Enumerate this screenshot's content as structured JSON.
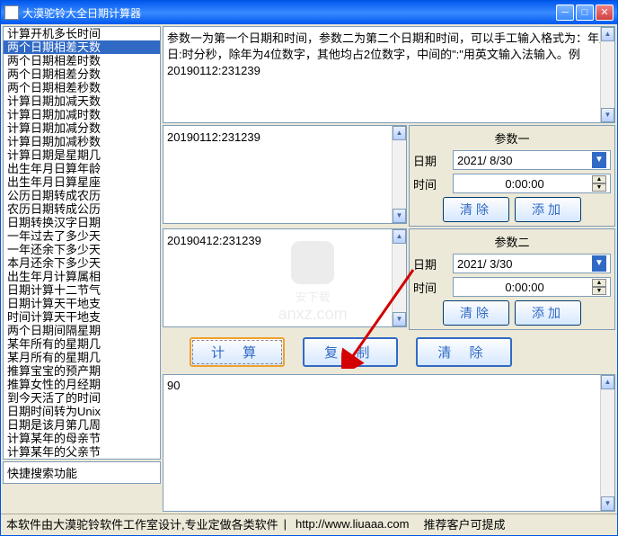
{
  "window": {
    "title": "大漠驼铃大全日期计算器"
  },
  "sidebar": {
    "items": [
      "计算开机多长时间",
      "两个日期相差天数",
      "两个日期相差时数",
      "两个日期相差分数",
      "两个日期相差秒数",
      "计算日期加减天数",
      "计算日期加减时数",
      "计算日期加减分数",
      "计算日期加减秒数",
      "计算日期是星期几",
      "出生年月日算年龄",
      "出生年月日算星座",
      "公历日期转成农历",
      "农历日期转成公历",
      "日期转换汉字日期",
      "一年过去了多少天",
      "一年还余下多少天",
      "本月还余下多少天",
      "出生年月计算属相",
      "日期计算十二节气",
      "日期计算天干地支",
      "时间计算天干地支",
      "两个日期间隔星期",
      "某年所有的星期几",
      "某月所有的星期几",
      "推算宝宝的预产期",
      "推算女性的月经期",
      "到今天活了的时间",
      "日期时间转为Unix",
      "日期是该月第几周",
      "计算某年的母亲节",
      "计算某年的父亲节"
    ],
    "selected_index": 1,
    "search_label": "快捷搜索功能"
  },
  "description": "参数一为第一个日期和时间，参数二为第二个日期和时间，可以手工输入格式为：年月日:时分秒，除年为4位数字，其他均占2位数字，中间的\":\"用英文输入法输入。例20190112:231239",
  "param1": {
    "input_value": "20190112:231239",
    "group_label": "参数一",
    "date_label": "日期",
    "date_value": "2021/ 8/30",
    "time_label": "时间",
    "time_value": "0:00:00",
    "clear_btn": "清除",
    "add_btn": "添加"
  },
  "param2": {
    "input_value": "20190412:231239",
    "group_label": "参数二",
    "date_label": "日期",
    "date_value": "2021/ 3/30",
    "time_label": "时间",
    "time_value": "0:00:00",
    "clear_btn": "清除",
    "add_btn": "添加"
  },
  "actions": {
    "calc": "计 算",
    "copy": "复 制",
    "clear": "清 除"
  },
  "result": "90",
  "statusbar": {
    "text1": "本软件由大漠驼铃软件工作室设计,专业定做各类软件",
    "url": "http://www.liuaaa.com",
    "text2": "推荐客户可提成"
  },
  "watermark": {
    "text1": "安下载",
    "text2": "anxz.com"
  }
}
